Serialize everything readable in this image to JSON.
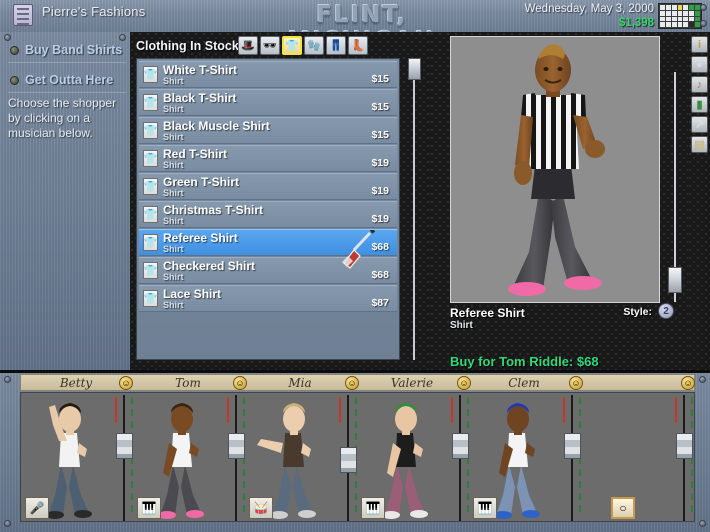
{
  "window": {
    "app_icon": "document-icon",
    "app_title": "Pierre's Fashions",
    "city_title": "FLINT, MICHIGAN",
    "date": "Wednesday, May 3, 2000",
    "money": "$1,398",
    "calendar_icon": "calendar-icon"
  },
  "sidebar": {
    "buttons": [
      {
        "label": "Buy Band Shirts",
        "name": "buy-band-shirts"
      },
      {
        "label": "Get Outta Here",
        "name": "get-outta-here"
      }
    ],
    "hint": "Choose the shopper by clicking on a musician below."
  },
  "shop": {
    "stock_label": "Clothing In Stock:",
    "categories": [
      {
        "name": "hat-category-icon",
        "glyph": "🎩",
        "selected": false
      },
      {
        "name": "accessory-category-icon",
        "glyph": "🕶",
        "selected": false
      },
      {
        "name": "shirt-category-icon",
        "glyph": "👕",
        "selected": true
      },
      {
        "name": "gloves-category-icon",
        "glyph": "🧤",
        "selected": false
      },
      {
        "name": "pants-category-icon",
        "glyph": "👖",
        "selected": false
      },
      {
        "name": "boots-category-icon",
        "glyph": "👢",
        "selected": false
      }
    ],
    "items": [
      {
        "name": "White T-Shirt",
        "type": "Shirt",
        "price": "$15",
        "selected": false
      },
      {
        "name": "Black T-Shirt",
        "type": "Shirt",
        "price": "$15",
        "selected": false
      },
      {
        "name": "Black Muscle Shirt",
        "type": "Shirt",
        "price": "$15",
        "selected": false
      },
      {
        "name": "Red T-Shirt",
        "type": "Shirt",
        "price": "$19",
        "selected": false
      },
      {
        "name": "Green T-Shirt",
        "type": "Shirt",
        "price": "$19",
        "selected": false
      },
      {
        "name": "Christmas T-Shirt",
        "type": "Shirt",
        "price": "$19",
        "selected": false
      },
      {
        "name": "Referee Shirt",
        "type": "Shirt",
        "price": "$68",
        "selected": true
      },
      {
        "name": "Checkered Shirt",
        "type": "Shirt",
        "price": "$68",
        "selected": false
      },
      {
        "name": "Lace Shirt",
        "type": "Shirt",
        "price": "$87",
        "selected": false
      }
    ]
  },
  "preview": {
    "item_name": "Referee Shirt",
    "item_type": "Shirt",
    "style_label": "Style:",
    "style_value": "2",
    "buy_line": "Buy for Tom Riddle: $68"
  },
  "tools": [
    {
      "name": "info-tool-icon",
      "glyph": "i"
    },
    {
      "name": "disc-tool-icon",
      "glyph": "●"
    },
    {
      "name": "guitar-tool-icon",
      "glyph": "♪"
    },
    {
      "name": "bottle-tool-icon",
      "glyph": "▮"
    },
    {
      "name": "chart-tool-icon",
      "glyph": "↗"
    },
    {
      "name": "money-tool-icon",
      "glyph": "▤"
    }
  ],
  "band": {
    "members": [
      {
        "name": "Betty",
        "instrument": "microphone-icon",
        "instrument_glyph": "🎤",
        "selected": false
      },
      {
        "name": "Tom",
        "instrument": "keyboard-icon",
        "instrument_glyph": "🎹",
        "selected": false
      },
      {
        "name": "Mia",
        "instrument": "drums-icon",
        "instrument_glyph": "🥁",
        "selected": false
      },
      {
        "name": "Valerie",
        "instrument": "keyboard-icon",
        "instrument_glyph": "🎹",
        "selected": false
      },
      {
        "name": "Clem",
        "instrument": "keyboard-icon",
        "instrument_glyph": "🎹",
        "selected": false
      },
      {
        "name": "",
        "instrument": "tambourine-icon",
        "instrument_glyph": "○",
        "selected": true
      }
    ]
  },
  "colors": {
    "accent_green": "#2fd97a",
    "selection_blue": "#3f90e2",
    "panel_metal": "#7b8ba0",
    "mesh_dark": "#191919",
    "nameplate": "#ded2b4"
  }
}
